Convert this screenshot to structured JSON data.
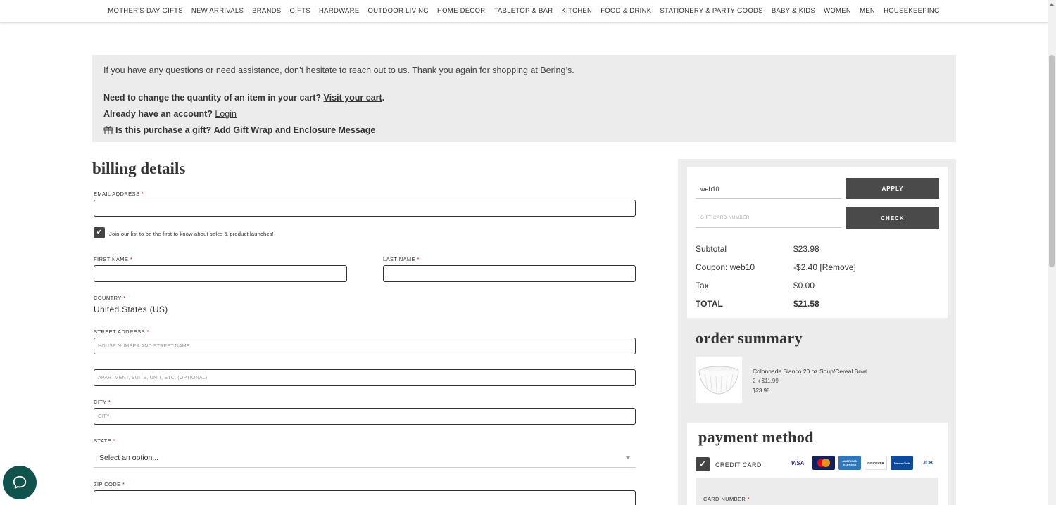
{
  "nav": {
    "items": [
      "MOTHER'S DAY GIFTS",
      "NEW ARRIVALS",
      "BRANDS",
      "GIFTS",
      "HARDWARE",
      "OUTDOOR LIVING",
      "HOME DECOR",
      "TABLETOP & BAR",
      "KITCHEN",
      "FOOD & DRINK",
      "STATIONERY & PARTY GOODS",
      "BABY & KIDS",
      "WOMEN",
      "MEN",
      "HOUSEKEEPING"
    ]
  },
  "notice": {
    "intro": "If you have any questions or need assistance, don’t hesitate to reach out to us. Thank you again for shopping at Bering’s.",
    "cart_question": "Need to change the quantity of an item in your cart?",
    "cart_link": "Visit your cart",
    "cart_period": ".",
    "account_question": "Already have an account?",
    "login_link": "Login",
    "gift_question": "Is this purchase a gift?",
    "gift_link": "Add Gift Wrap and Enclosure Message"
  },
  "billing": {
    "title": "billing details",
    "email_label": "EMAIL ADDRESS",
    "required_mark": "*",
    "newsletter_label": "Join our list to be the first to know about sales & product launches!",
    "first_name_label": "FIRST NAME",
    "last_name_label": "LAST NAME",
    "country_label": "COUNTRY",
    "country_value": "United States (US)",
    "street_label": "STREET ADDRESS",
    "street_placeholder": "HOUSE NUMBER AND STREET NAME",
    "street2_placeholder": "APARTMENT, SUITE, UNIT, ETC. (OPTIONAL)",
    "city_label": "CITY",
    "city_placeholder": "CITY",
    "state_label": "STATE",
    "state_value": "Select an option...",
    "zip_label": "ZIP CODE"
  },
  "coupon": {
    "code_value": "web10",
    "apply_label": "APPLY",
    "gift_card_placeholder": "GIFT CARD NUMBER",
    "check_label": "CHECK"
  },
  "totals": {
    "subtotal_label": "Subtotal",
    "subtotal_value": "$23.98",
    "coupon_label": "Coupon: web10",
    "coupon_value": "-$2.40",
    "remove_link": "[Remove]",
    "tax_label": "Tax",
    "tax_value": "$0.00",
    "total_label": "TOTAL",
    "total_value": "$21.58"
  },
  "order_summary": {
    "title": "order summary",
    "product_name": "Colonnade Blanco 20 oz Soup/Cereal Bowl",
    "product_qty": "2 x $11.99",
    "product_total": "$23.98"
  },
  "payment": {
    "title": "payment method",
    "method_label": "CREDIT CARD",
    "card_logos": [
      "VISA",
      "mastercard",
      "AMERICAN EXPRESS",
      "DISCOVER",
      "Diners Club",
      "JCB"
    ],
    "card_number_label": "CARD NUMBER"
  },
  "colors": {
    "dark_button": "#4a4a4a",
    "panel_gray": "#ececec",
    "chat_green": "#10534d"
  }
}
